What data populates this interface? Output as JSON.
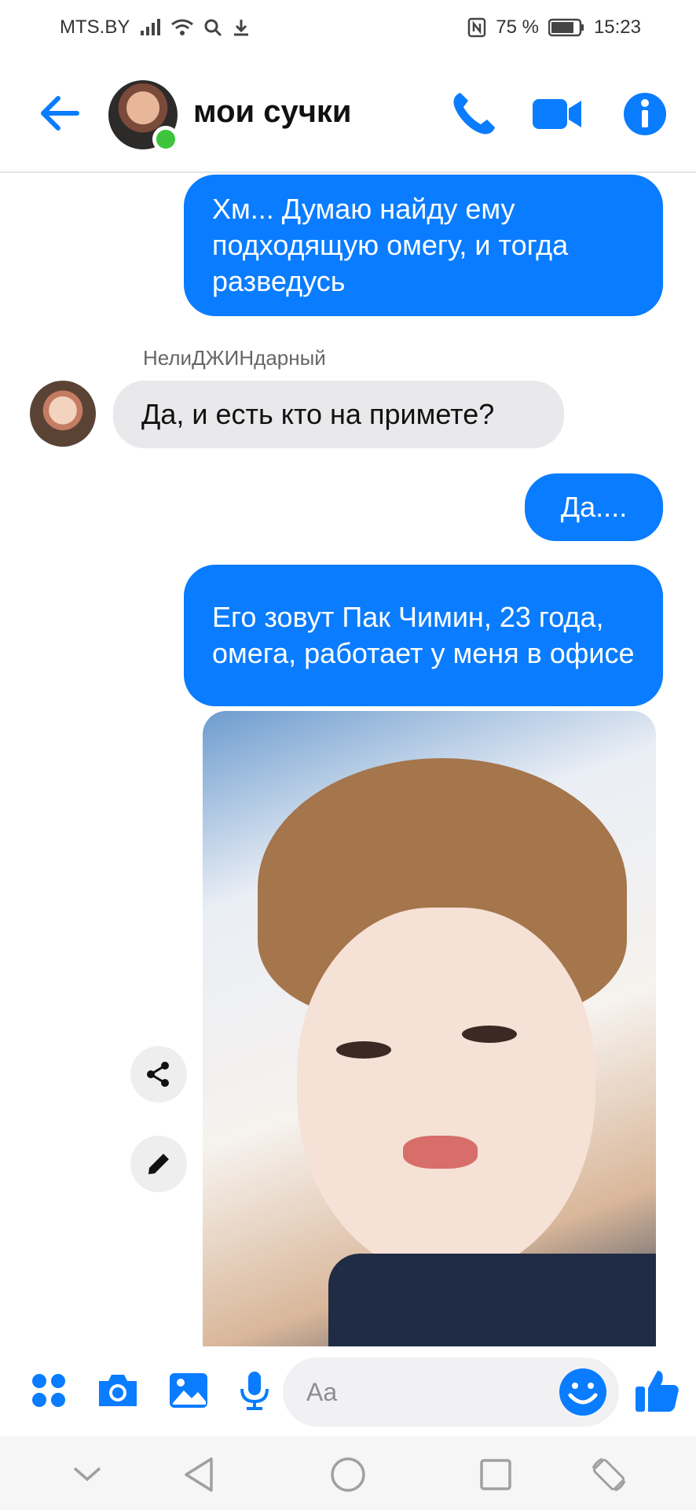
{
  "status_bar": {
    "carrier": "MTS.BY",
    "battery": "75 %",
    "time": "15:23"
  },
  "header": {
    "title": "мои сучки",
    "status": "online"
  },
  "messages": [
    {
      "direction": "out",
      "text": "Хм... Думаю найду ему подходящую омегу, и тогда разведусь"
    },
    {
      "direction": "in",
      "sender": "НелиДЖИНдарный",
      "text": "Да, и есть кто на примете?"
    },
    {
      "direction": "out",
      "text": "Да...."
    },
    {
      "direction": "out",
      "text": "Его зовут Пак Чимин, 23 года, омега, работает у меня в офисе"
    },
    {
      "direction": "out",
      "type": "photo"
    }
  ],
  "composer": {
    "placeholder": "Aa"
  },
  "icons": {
    "back": "arrow-left-icon",
    "call": "phone-icon",
    "video": "video-camera-icon",
    "info": "info-icon",
    "menu": "apps-grid-icon",
    "camera": "camera-icon",
    "gallery": "image-icon",
    "mic": "microphone-icon",
    "emoji": "smiley-icon",
    "like": "thumbs-up-icon",
    "share": "share-icon",
    "edit": "pencil-icon"
  },
  "colors": {
    "accent": "#0a7cff",
    "incoming_bubble": "#e9e9ec",
    "online": "#3ec43c"
  }
}
